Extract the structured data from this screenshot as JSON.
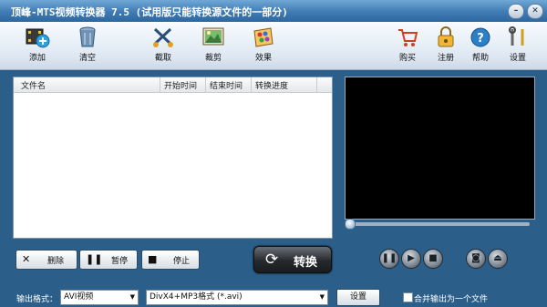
{
  "window": {
    "title": "顶峰-MTS视频转换器 7.5 (试用版只能转换源文件的一部分)",
    "minimize": "–",
    "close": "✕"
  },
  "toolbar": {
    "add": "添加",
    "clear": "清空",
    "cut": "截取",
    "crop": "裁剪",
    "effect": "效果",
    "buy": "购买",
    "register": "注册",
    "help": "帮助",
    "settings": "设置"
  },
  "file_list": {
    "columns": [
      "文件名",
      "开始时间",
      "结束时间",
      "转换进度"
    ],
    "rows": []
  },
  "actions": {
    "delete": "删除",
    "pause": "暂停",
    "stop": "停止",
    "convert": "转换"
  },
  "bottom": {
    "output_format_label": "输出格式：",
    "format_category": "AVI视频",
    "format_detail": "DivX4+MP3格式 (*.avi)",
    "settings_button": "设置",
    "merge_label": "合并输出为一个文件"
  },
  "colors": {
    "frame": "#2b5f8a",
    "preview_bg": "#000000",
    "toolbar_bg": "#dfe9f3"
  }
}
